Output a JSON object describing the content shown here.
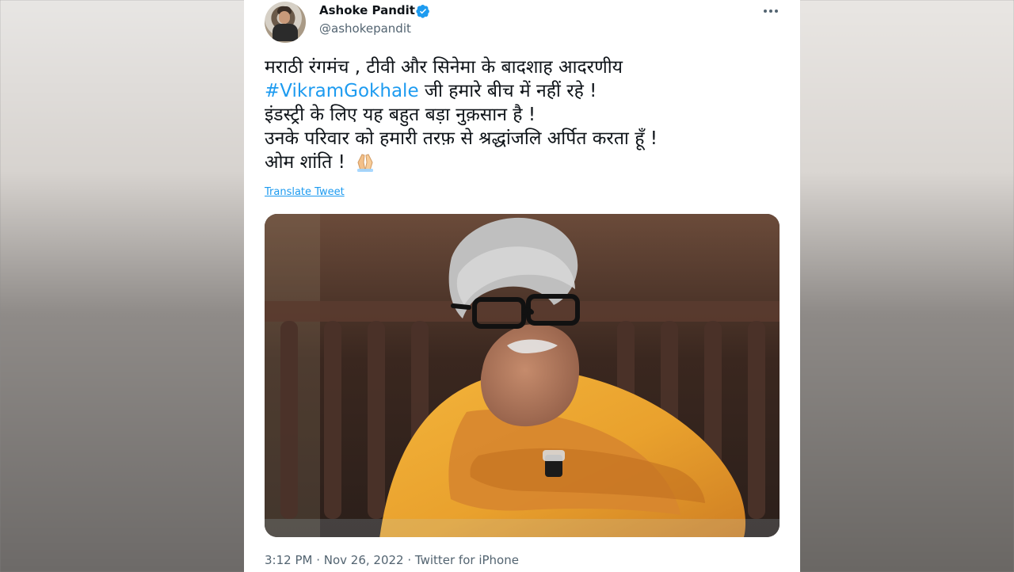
{
  "tweet": {
    "author_name": "Ashoke Pandit",
    "author_handle": "@ashokepandit",
    "more_icon": "more-horizontal-icon",
    "text_lines": [
      "मराठी रंगमंच , टीवी और सिनेमा के बादशाह आदरणीय",
      "जी हमारे बीच में नहीं रहे !",
      "इंडस्ट्री के लिए यह बहुत बड़ा नुक़सान है !",
      "उनके परिवार को हमारी तरफ़ से श्रद्धांजलि अर्पित करता हूँ !",
      "ओम शांति !"
    ],
    "hashtag": "#VikramGokhale",
    "translate_label": "Translate Tweet",
    "footer_meta": "3:12 PM · Nov 26, 2022 · Twitter for iPhone"
  },
  "colors": {
    "accent": "#1d9bf0",
    "text_primary": "#0f1419",
    "text_secondary": "#536471"
  }
}
